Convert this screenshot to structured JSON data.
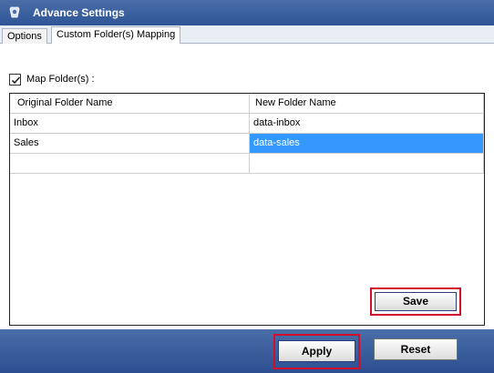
{
  "window": {
    "title": "Advance Settings",
    "icon": "settings-gear-icon"
  },
  "tabs": [
    {
      "label": "Options",
      "active": false
    },
    {
      "label": "Custom Folder(s) Mapping",
      "active": true
    }
  ],
  "map_folders": {
    "label": "Map Folder(s) :",
    "checked": true
  },
  "grid": {
    "headers": [
      "Original Folder Name",
      "New Folder Name"
    ],
    "rows": [
      {
        "original": "Inbox",
        "new": "data-inbox",
        "selected_cell": null
      },
      {
        "original": "Sales",
        "new": "data-sales",
        "selected_cell": "new"
      },
      {
        "original": "",
        "new": "",
        "selected_cell": null
      }
    ]
  },
  "buttons": {
    "save": "Save",
    "apply": "Apply",
    "reset": "Reset"
  },
  "colors": {
    "titlebar": "#2f5597",
    "selection": "#3399ff",
    "highlight_outline": "#d0102a"
  }
}
